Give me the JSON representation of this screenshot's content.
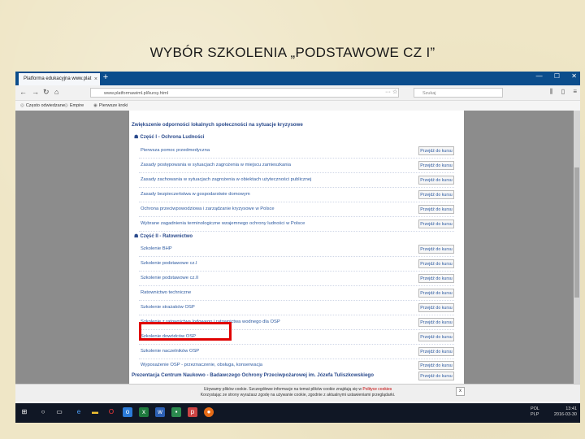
{
  "slide_title": "WYBÓR SZKOLENIA „PODSTAWOWE CZ I”",
  "browser": {
    "tab_title": "Platforma edukacyjna www.plat",
    "url": "www.platformawiml.pl/kursy.html",
    "search_placeholder": "Szukaj",
    "bookmarks": [
      "Często odwiedzane",
      "Empire",
      "Pierwsze kroki"
    ]
  },
  "page": {
    "main_heading": "Zwiększenie odporności lokalnych społeczności na sytuacje kryzysowe",
    "part1": {
      "title": "Część I - Ochrona Ludności",
      "courses": [
        "Pierwsza pomoc przedmedyczna",
        "Zasady postępowania w sytuacjach zagrożenia w miejscu zamieszkania",
        "Zasady zachowania w sytuacjach zagrożenia w obiektach użyteczności publicznej",
        "Zasady bezpieczeństwa w gospodarstwie domowym",
        "Ochrona przeciwpowodziowa i zarządzanie kryzysowe w Polsce",
        "Wybrane zagadnienia terminologiczne wzajemnego ochrony ludności w Polsce"
      ]
    },
    "part2": {
      "title": "Część II - Ratownictwo",
      "courses": [
        "Szkolenie BHP",
        "Szkolenie podstawowe cz.I",
        "Szkolenie podstawowe cz.II",
        "Ratownictwo techniczne",
        "Szkolenie strażaków OSP",
        "Szkolenie z ratownictwa lodowego i ratownictwa wodnego dla OSP",
        "Szkolenie dowódców OSP",
        "Szkolenie naczelników OSP",
        "Wyposażenie OSP - przeznaczenie, obsługa, konserwacja"
      ]
    },
    "button_label": "Przejdź do kursu",
    "footer_section": "Prezentacja Centrum Naukowo - Badawczego Ochrony Przeciwpożarowej im. Józefa Tuliszkowskiego"
  },
  "cookie": {
    "line1": "Używamy plików cookie. Szczegółowe informacje na temat plików cookie znajdują się w",
    "link": "Polityce cookies",
    "line2": "Korzystając ze strony wyrażasz zgodę na używanie cookie, zgodnie z aktualnymi ustawieniami przeglądarki.",
    "close": "x"
  },
  "taskbar": {
    "lang_line1": "POL",
    "lang_line2": "PLP",
    "time": "13:41",
    "date": "2016-03-30"
  }
}
